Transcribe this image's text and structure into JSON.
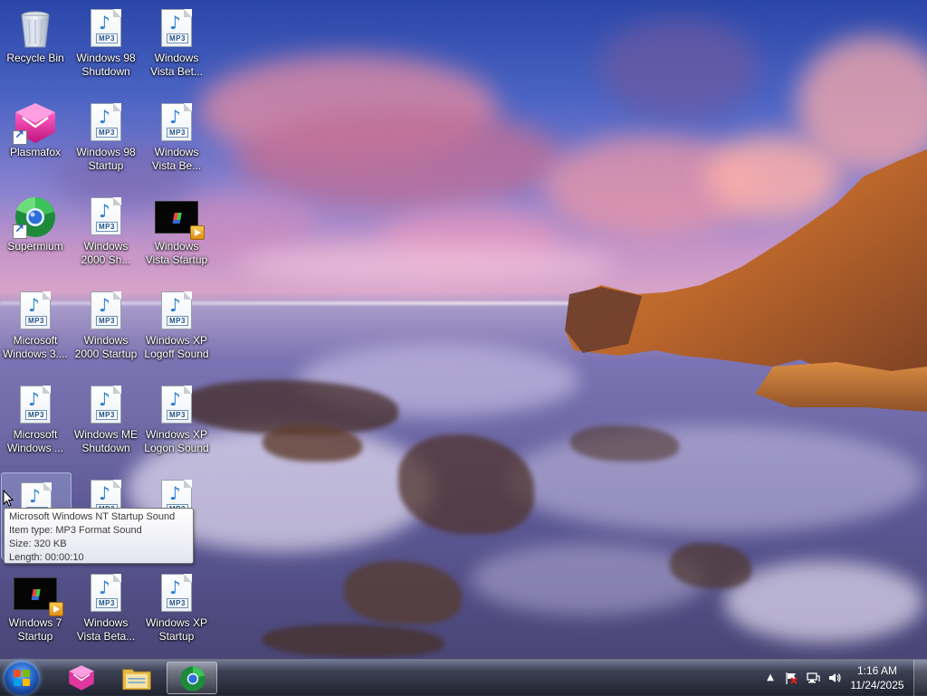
{
  "desktop": {
    "icons": [
      {
        "label": "Recycle Bin",
        "icon": "recycle-bin-icon"
      },
      {
        "label": "Windows 98 Shutdown",
        "icon": "mp3-file-icon"
      },
      {
        "label": "Windows Vista Bet...",
        "icon": "mp3-file-icon"
      },
      {
        "label": "Plasmafox",
        "icon": "plasmafox-icon"
      },
      {
        "label": "Windows 98 Startup",
        "icon": "mp3-file-icon"
      },
      {
        "label": "Windows Vista Be...",
        "icon": "mp3-file-icon"
      },
      {
        "label": "Supermium",
        "icon": "supermium-icon"
      },
      {
        "label": "Windows 2000 Sh...",
        "icon": "mp3-file-icon"
      },
      {
        "label": "Windows Vista Startup",
        "icon": "video-file-icon"
      },
      {
        "label": "Microsoft Windows 3....",
        "icon": "mp3-file-icon"
      },
      {
        "label": "Windows 2000 Startup",
        "icon": "mp3-file-icon"
      },
      {
        "label": "Windows XP Logoff Sound",
        "icon": "mp3-file-icon"
      },
      {
        "label": "Microsoft Windows ...",
        "icon": "mp3-file-icon"
      },
      {
        "label": "Windows ME Shutdown",
        "icon": "mp3-file-icon"
      },
      {
        "label": "Windows XP Logon Sound",
        "icon": "mp3-file-icon"
      },
      {
        "label": "",
        "icon": "mp3-file-icon"
      },
      {
        "label": "",
        "icon": "mp3-file-icon"
      },
      {
        "label": "",
        "icon": "mp3-file-icon"
      },
      {
        "label": "Windows 7 Startup",
        "icon": "video-file-icon"
      },
      {
        "label": "Windows Vista Beta...",
        "icon": "mp3-file-icon"
      },
      {
        "label": "Windows XP Startup",
        "icon": "mp3-file-icon"
      }
    ],
    "mp3_tag": "MP3"
  },
  "tooltip": {
    "lines": [
      "Microsoft Windows NT Startup Sound",
      "Item type: MP3 Format Sound",
      "Size: 320 KB",
      "Length: 00:00:10"
    ]
  },
  "taskbar": {
    "start_icon": "windows-start-orb-icon",
    "pinned": [
      {
        "icon": "plasmafox-icon",
        "active": false
      },
      {
        "icon": "file-explorer-icon",
        "active": false
      },
      {
        "icon": "supermium-icon",
        "active": true
      }
    ],
    "tray": {
      "icons": [
        "show-hidden-icons-chevron",
        "action-center-flag-icon",
        "network-icon",
        "volume-icon"
      ],
      "time": "1:16 AM",
      "date": "11/24/2025"
    }
  },
  "colors": {
    "taskbar": "#1c202a",
    "accent": "#2464c6"
  }
}
